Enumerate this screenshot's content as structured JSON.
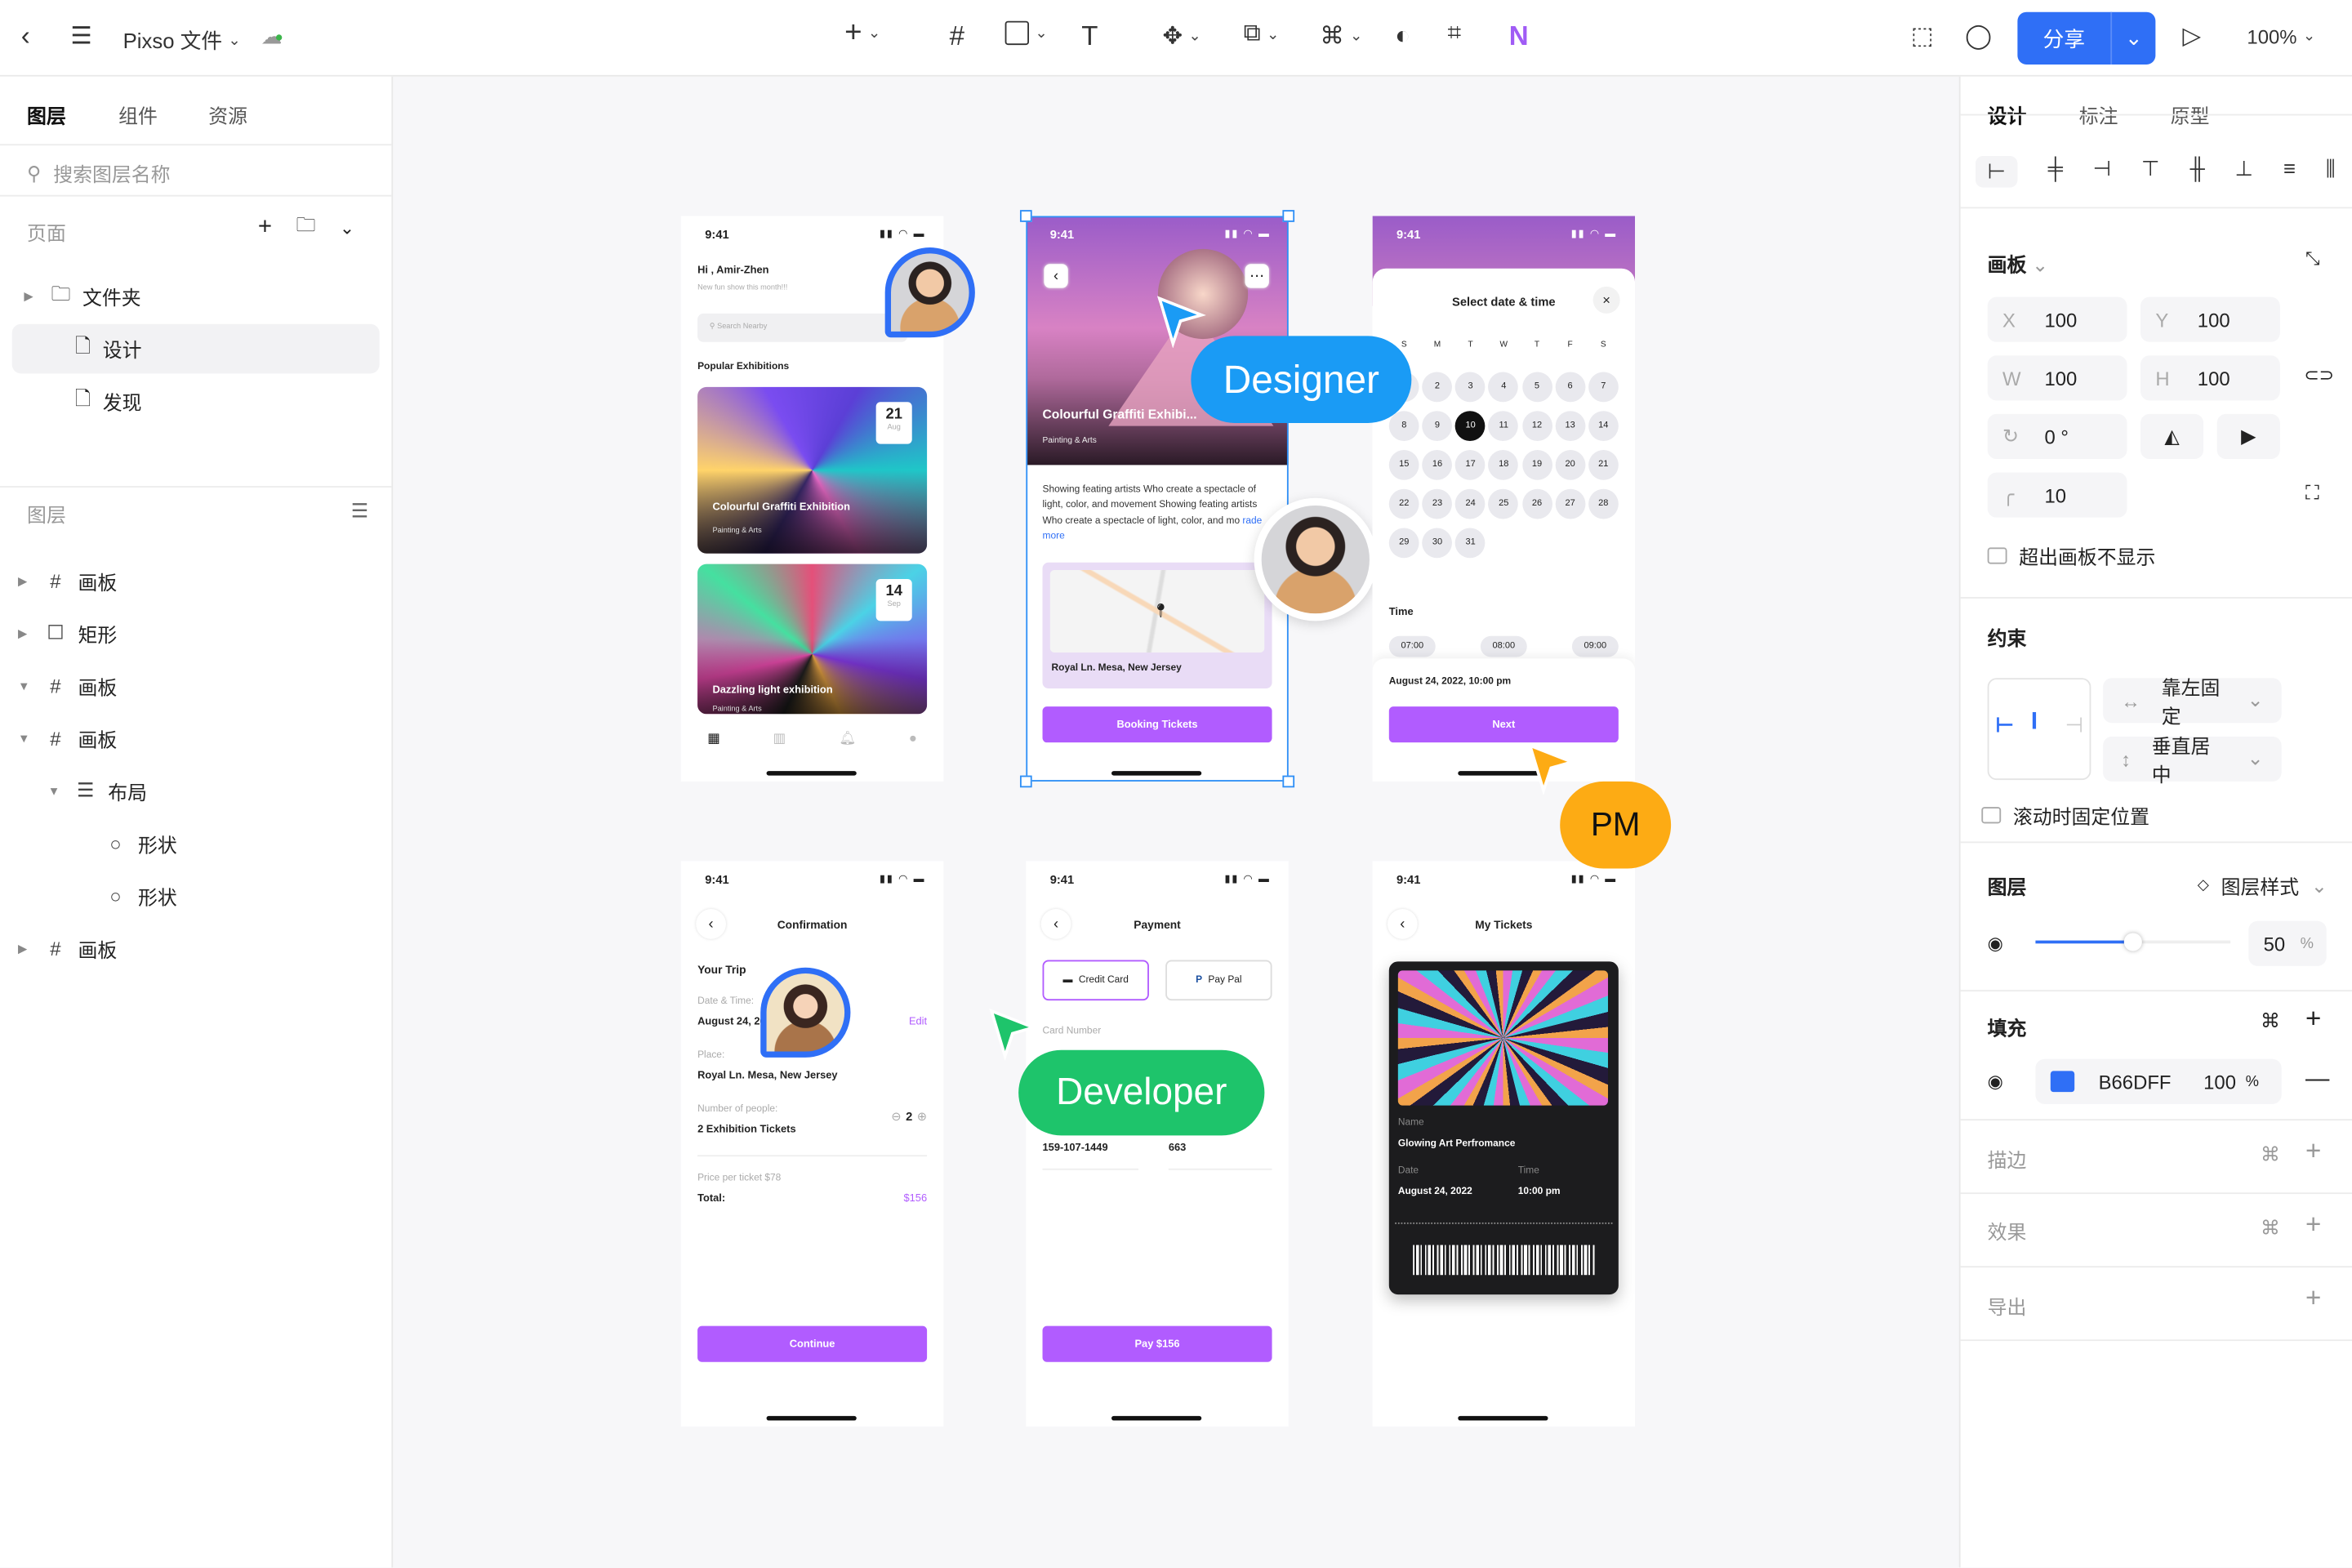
{
  "topbar": {
    "file_name": "Pixso 文件",
    "share_label": "分享",
    "zoom": "100%"
  },
  "left": {
    "tabs": [
      "图层",
      "组件",
      "资源"
    ],
    "search_placeholder": "搜索图层名称",
    "pages_title": "页面",
    "pages": [
      {
        "label": "文件夹",
        "icon": "folder-icon"
      },
      {
        "label": "设计",
        "icon": "page-icon",
        "selected": true
      },
      {
        "label": "发现",
        "icon": "page-icon"
      }
    ],
    "layers_title": "图层",
    "layers": [
      {
        "label": "画板",
        "icon": "frame-icon",
        "expanded": false,
        "depth": 0
      },
      {
        "label": "矩形",
        "icon": "rectangle-icon",
        "expanded": false,
        "depth": 0
      },
      {
        "label": "画板",
        "icon": "frame-icon",
        "expanded": true,
        "depth": 0
      },
      {
        "label": "画板",
        "icon": "frame-icon",
        "expanded": true,
        "depth": 0
      },
      {
        "label": "布局",
        "icon": "layout-icon",
        "expanded": true,
        "depth": 1
      },
      {
        "label": "形状",
        "icon": "ellipse-icon",
        "depth": 2
      },
      {
        "label": "形状",
        "icon": "ellipse-icon",
        "depth": 2
      },
      {
        "label": "画板",
        "icon": "frame-icon",
        "expanded": false,
        "depth": 0
      }
    ]
  },
  "right": {
    "tabs": [
      "设计",
      "标注",
      "原型"
    ],
    "frame_title": "画板",
    "x": "100",
    "y": "100",
    "w": "100",
    "h": "100",
    "rotation": "0 °",
    "radius": "10",
    "clip_label": "超出画板不显示",
    "constraints_title": "约束",
    "h_constraint": "靠左固定",
    "v_constraint": "垂直居中",
    "fix_scroll_label": "滚动时固定位置",
    "layer_title": "图层",
    "layer_style": "图层样式",
    "opacity": "50",
    "opacity_unit": "%",
    "opacity_value": 50,
    "fill_title": "填充",
    "fill_hex": "B66DFF",
    "fill_swatch": "#2f6ff6",
    "fill_opacity": "100",
    "fill_unit": "%",
    "stroke_title": "描边",
    "effect_title": "效果",
    "export_title": "导出"
  },
  "phones": {
    "time": "9:41",
    "home": {
      "greeting": "Hi , Amir-Zhen",
      "subtitle": "New fun show this month!!!",
      "search": "Search Nearby",
      "section": "Popular Exhibitions",
      "cards": [
        {
          "title": "Colourful Graffiti Exhibition",
          "tag": "Painting & Arts",
          "day": "21",
          "month": "Aug"
        },
        {
          "title": "Dazzling light exhibition",
          "tag": "Painting & Arts",
          "day": "14",
          "month": "Sep"
        }
      ]
    },
    "detail": {
      "title": "Colourful Graffiti Exhibi...",
      "tag": "Painting & Arts",
      "desc": "Showing feating artists Who create a spectacle of light, color, and movement Showing feating artists Who create a spectacle of light, color, and mo",
      "more": "rade more",
      "place": "Royal Ln. Mesa, New Jersey",
      "button": "Booking Tickets"
    },
    "date": {
      "title": "Select date & time",
      "weekdays": [
        "S",
        "M",
        "T",
        "W",
        "T",
        "F",
        "S"
      ],
      "days": [
        "1",
        "2",
        "3",
        "4",
        "5",
        "6",
        "7",
        "8",
        "9",
        "10",
        "11",
        "12",
        "13",
        "14",
        "15",
        "16",
        "17",
        "18",
        "19",
        "20",
        "21",
        "22",
        "23",
        "24",
        "25",
        "26",
        "27",
        "28",
        "29",
        "30",
        "31"
      ],
      "selected": "10",
      "time_label": "Time",
      "times": [
        "07:00",
        "08:00",
        "09:00"
      ],
      "summary": "August 24, 2022, 10:00 pm",
      "button": "Next"
    },
    "confirm": {
      "title": "Confirmation",
      "your_trip": "Your Trip",
      "date_label": "Date & Time:",
      "date": "August 24, 2022",
      "edit": "Edit",
      "place_label": "Place:",
      "place": "Royal Ln. Mesa, New Jersey",
      "people_label": "Number of people:",
      "tickets": "2 Exhibition Tickets",
      "count": "2",
      "price": "Price per ticket $78",
      "total_label": "Total:",
      "total": "$156",
      "button": "Continue"
    },
    "payment": {
      "title": "Payment",
      "credit": "Credit Card",
      "paypal": "Pay Pal",
      "card_label": "Card Number",
      "card_number": "159-107-1449",
      "cvv": "663",
      "button": "Pay $156"
    },
    "tickets": {
      "title": "My Tickets",
      "name_label": "Name",
      "name": "Glowing Art Perfromance",
      "date_label": "Date",
      "date": "August 24, 2022",
      "time_label": "Time",
      "time": "10:00 pm"
    }
  },
  "cursors": {
    "designer": "Designer",
    "developer": "Developer",
    "pm": "PM",
    "designer_color": "#1a9bf5",
    "developer_color": "#1ec46b",
    "pm_color": "#fdab14"
  }
}
